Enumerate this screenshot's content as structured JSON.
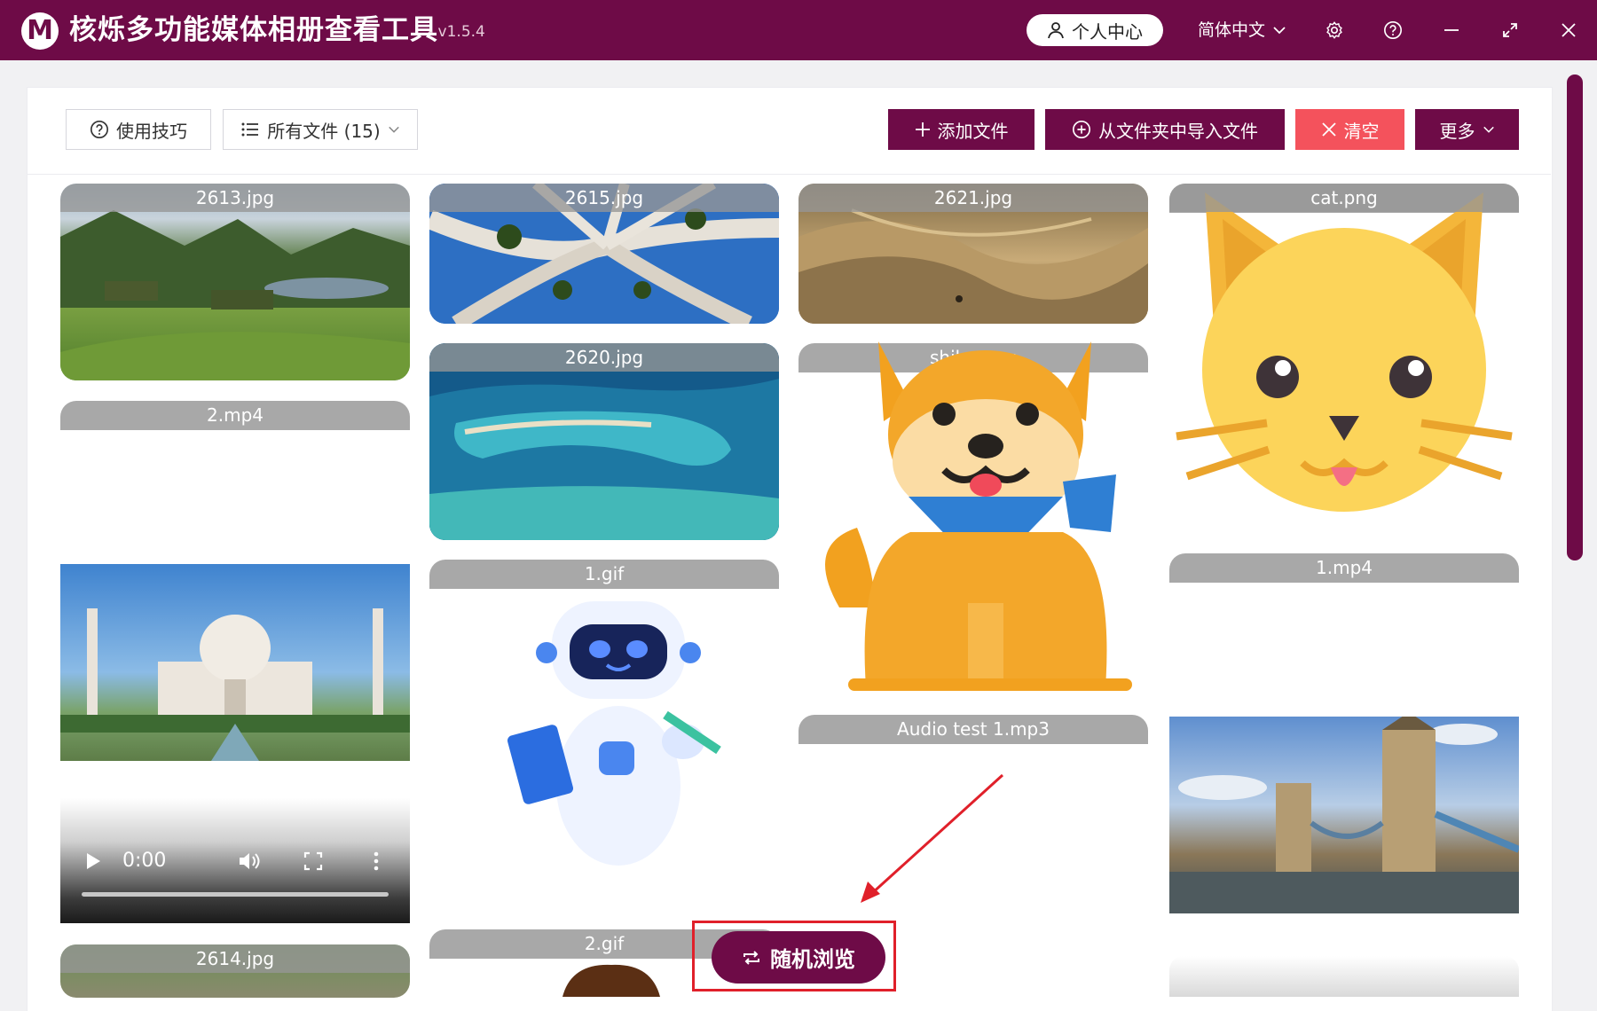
{
  "app": {
    "logo": "M",
    "title": "核烁多功能媒体相册查看工具",
    "version": "- v1.5.4",
    "user_center": "个人中心",
    "language": "简体中文"
  },
  "toolbar": {
    "tips": "使用技巧",
    "filter": "所有文件 (15)",
    "add_files": "添加文件",
    "import_folder": "从文件夹中导入文件",
    "clear": "清空",
    "more": "更多"
  },
  "gallery": {
    "items": [
      {
        "name": "2613.jpg"
      },
      {
        "name": "2615.jpg"
      },
      {
        "name": "2621.jpg"
      },
      {
        "name": "cat.png"
      },
      {
        "name": "2620.jpg"
      },
      {
        "name": "shiba.png"
      },
      {
        "name": "2.mp4"
      },
      {
        "name": "1.gif"
      },
      {
        "name": "1.mp4"
      },
      {
        "name": "Audio test 1.mp3"
      },
      {
        "name": "2614.jpg"
      },
      {
        "name": "2.gif"
      }
    ]
  },
  "video_player": {
    "time": "0:00"
  },
  "random_browse": {
    "label": "随机浏览"
  },
  "colors": {
    "brand": "#6e0b47",
    "danger": "#f4525c",
    "highlight_box": "#e0202a"
  }
}
